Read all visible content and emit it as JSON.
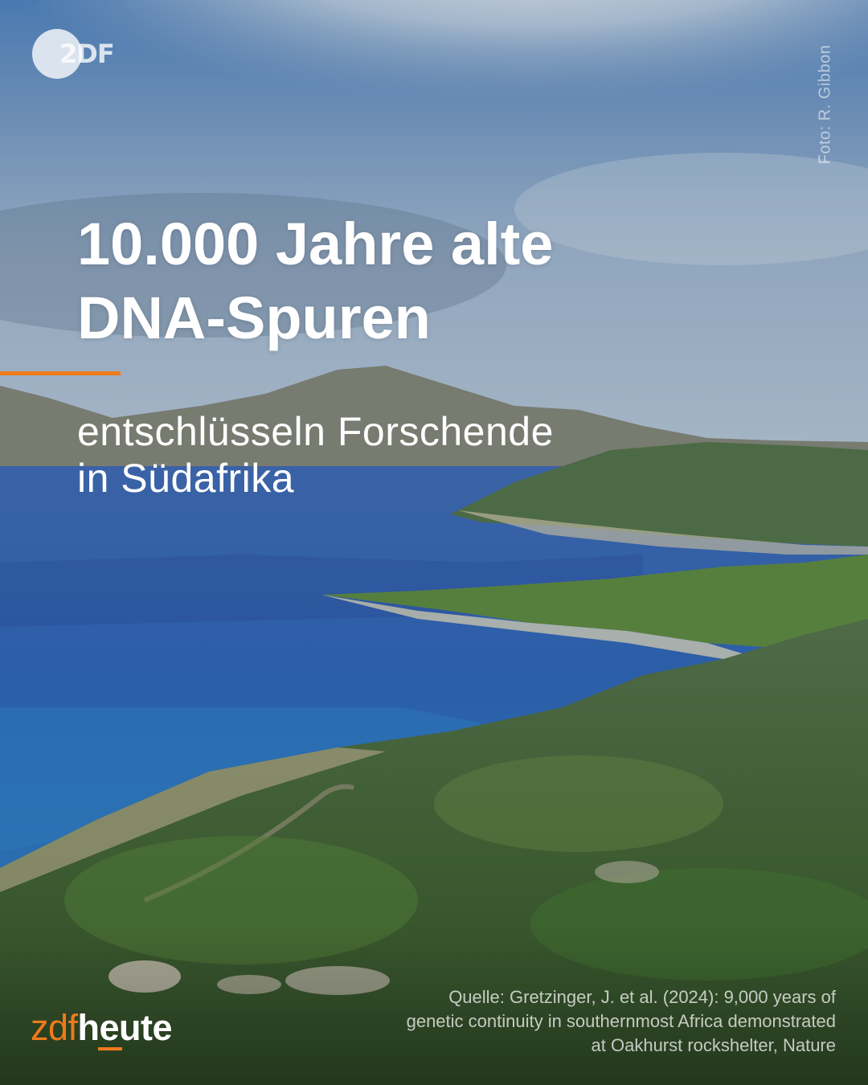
{
  "brand": {
    "top_logo_text": "2DF",
    "bottom_logo_zdf": "zdf",
    "bottom_logo_heute": "heute",
    "accent_color": "#ef7a1a"
  },
  "photo_credit": "Foto: R. Gibbon",
  "headline": {
    "line1": "10.000 Jahre alte",
    "line2": "DNA-Spuren"
  },
  "subline": {
    "line1": "entschlüsseln Forschende",
    "line2": "in Südafrika"
  },
  "source": {
    "line1": "Quelle: Gretzinger, J. et al. (2024): 9,000 years of",
    "line2": "genetic continuity in southernmost Africa demonstrated",
    "line3": "at Oakhurst rockshelter, Nature"
  }
}
